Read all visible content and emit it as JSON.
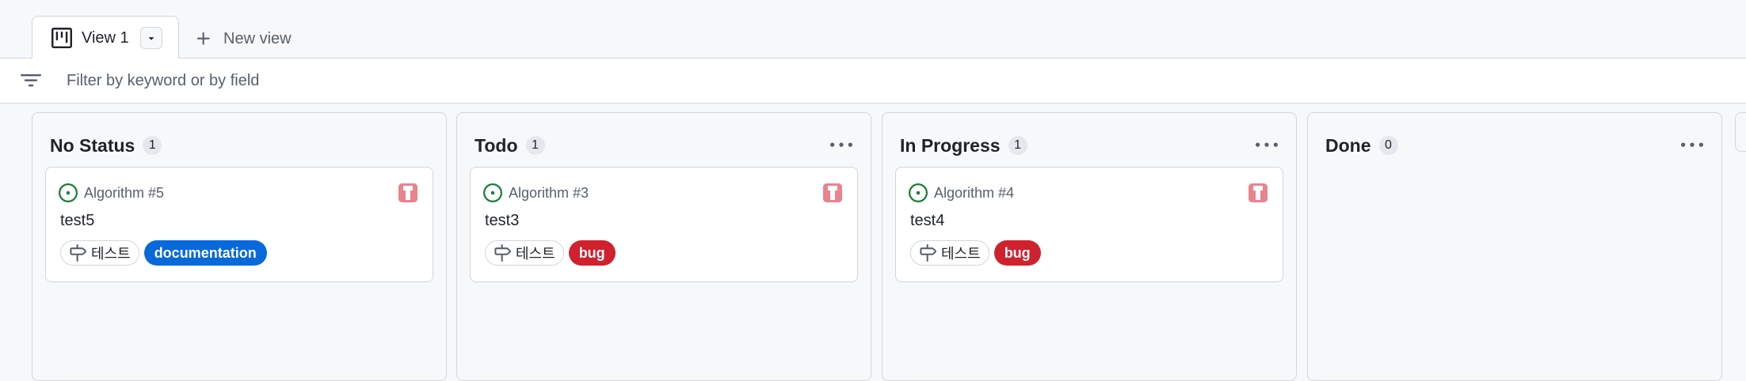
{
  "tabs": {
    "active_label": "View 1",
    "new_view_label": "New view"
  },
  "filter": {
    "placeholder": "Filter by keyword or by field"
  },
  "colors": {
    "documentation": "#0969da",
    "bug": "#cf222e",
    "open_status": "#1a7f37",
    "avatar": "#e8838f"
  },
  "columns": [
    {
      "title": "No Status",
      "count": "1",
      "card": {
        "ref": "Algorithm #5",
        "title": "test5",
        "field": "테스트",
        "label": "documentation"
      }
    },
    {
      "title": "Todo",
      "count": "1",
      "card": {
        "ref": "Algorithm #3",
        "title": "test3",
        "field": "테스트",
        "label": "bug"
      }
    },
    {
      "title": "In Progress",
      "count": "1",
      "card": {
        "ref": "Algorithm #4",
        "title": "test4",
        "field": "테스트",
        "label": "bug"
      }
    },
    {
      "title": "Done",
      "count": "0"
    }
  ],
  "icons": [
    "project-board-icon",
    "triangle-down-icon",
    "plus-icon",
    "filter-icon",
    "kebab-horizontal-icon",
    "issue-opened-icon",
    "avatar-identicon",
    "milestone-icon"
  ]
}
